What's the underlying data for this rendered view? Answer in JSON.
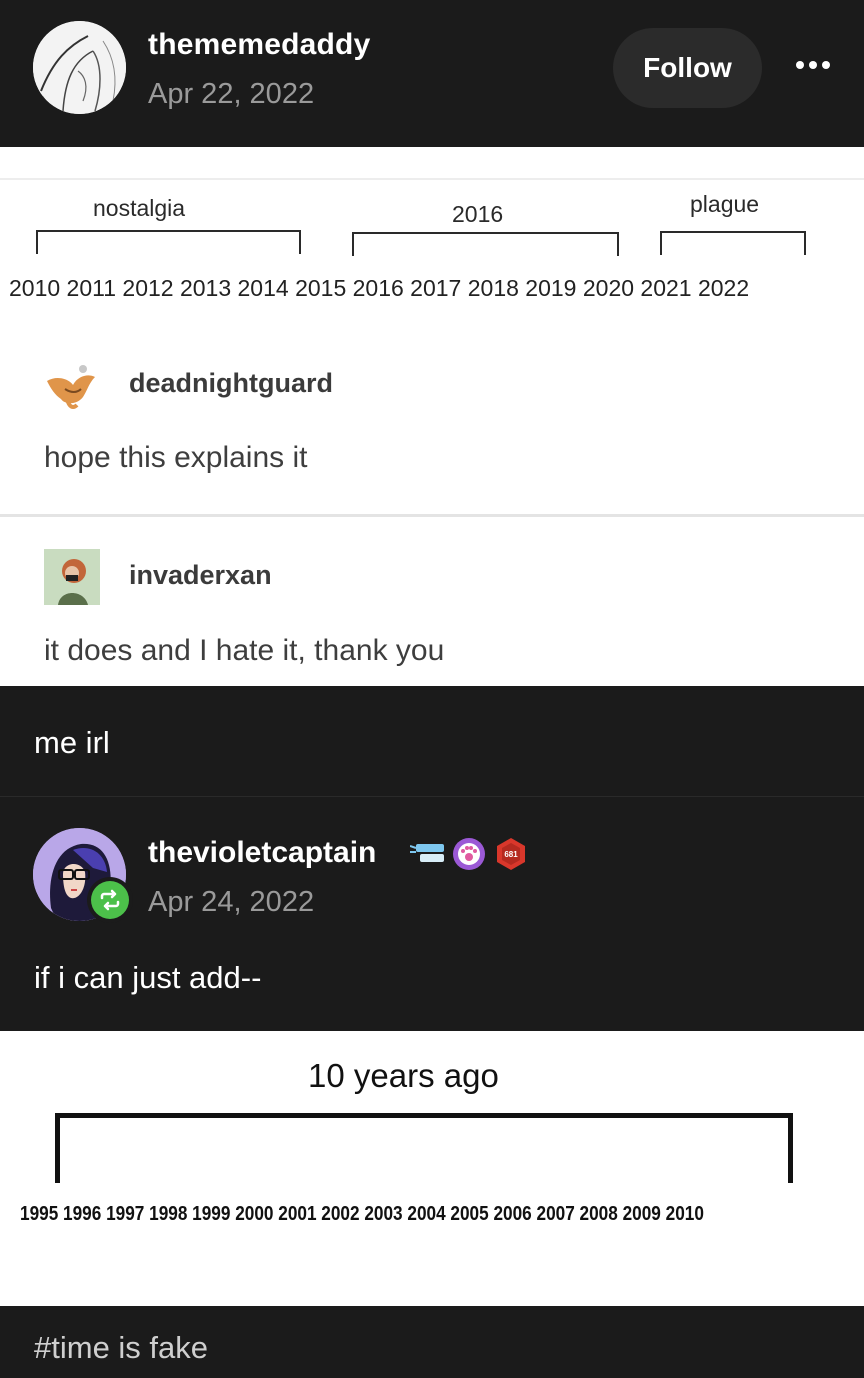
{
  "post": {
    "author": "thememedaddy",
    "date": "Apr 22, 2022",
    "follow_label": "Follow",
    "more_icon": "more-dots-icon"
  },
  "screenshot1": {
    "brackets": [
      {
        "label": "nostalgia"
      },
      {
        "label": "2016"
      },
      {
        "label": "plague"
      }
    ],
    "years": "2010 2011 2012 2013 2014 2015 2016 2017 2018 2019 2020 2021 2022",
    "comments": [
      {
        "user": "deadnightguard",
        "text": "hope this explains it"
      },
      {
        "user": "invaderxan",
        "text": "it does and I hate it, thank you"
      }
    ]
  },
  "caption": "me irl",
  "reblog": {
    "author": "thevioletcaptain",
    "date": "Apr 24, 2022",
    "text": "if i can just add--",
    "badge_number": "681"
  },
  "screenshot2": {
    "label": "10 years ago",
    "years": "1995 1996 1997 1998 1999 2000 2001 2002 2003 2004 2005 2006 2007 2008 2009 2010"
  },
  "tags": "#time is fake",
  "colors": {
    "background": "#1b1b1b",
    "follow_button": "#2b2b2b",
    "reblog_green": "#4cc04a",
    "muted_text": "#9a9a9a"
  }
}
